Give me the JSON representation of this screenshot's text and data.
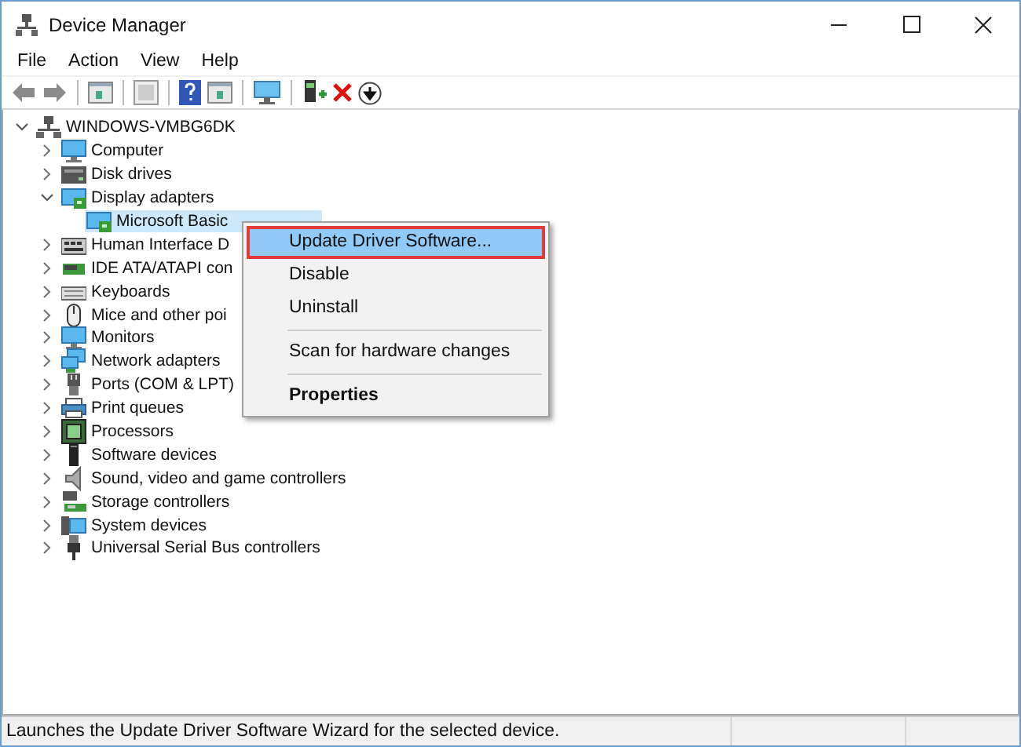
{
  "window": {
    "title": "Device Manager"
  },
  "menu_bar": [
    "File",
    "Action",
    "View",
    "Help"
  ],
  "tree": [
    {
      "label": "WINDOWS-VMBG6DK",
      "expanded": true,
      "selected": false,
      "children": [
        {
          "label": "Computer",
          "expanded": false,
          "selected": false
        },
        {
          "label": "Disk drives",
          "expanded": false,
          "selected": false
        },
        {
          "label": "Display adapters",
          "expanded": true,
          "selected": false,
          "children": [
            {
              "label": "Microsoft Basic",
              "selected": true
            }
          ]
        },
        {
          "label": "Human Interface D",
          "expanded": false,
          "selected": false
        },
        {
          "label": "IDE ATA/ATAPI con",
          "expanded": false,
          "selected": false
        },
        {
          "label": "Keyboards",
          "expanded": false,
          "selected": false
        },
        {
          "label": "Mice and other poi",
          "expanded": false,
          "selected": false
        },
        {
          "label": "Monitors",
          "expanded": false,
          "selected": false
        },
        {
          "label": "Network adapters",
          "expanded": false,
          "selected": false
        },
        {
          "label": "Ports (COM & LPT)",
          "expanded": false,
          "selected": false
        },
        {
          "label": "Print queues",
          "expanded": false,
          "selected": false
        },
        {
          "label": "Processors",
          "expanded": false,
          "selected": false
        },
        {
          "label": "Software devices",
          "expanded": false,
          "selected": false
        },
        {
          "label": "Sound, video and game controllers",
          "expanded": false,
          "selected": false
        },
        {
          "label": "Storage controllers",
          "expanded": false,
          "selected": false
        },
        {
          "label": "System devices",
          "expanded": false,
          "selected": false
        },
        {
          "label": "Universal Serial Bus controllers",
          "expanded": false,
          "selected": false
        }
      ]
    }
  ],
  "context_menu": [
    {
      "kind": "item",
      "label": "Update Driver Software...",
      "selected": true,
      "outlined": true,
      "bold": false
    },
    {
      "kind": "item",
      "label": "Disable",
      "selected": false,
      "outlined": false,
      "bold": false
    },
    {
      "kind": "item",
      "label": "Uninstall",
      "selected": false,
      "outlined": false,
      "bold": false
    },
    {
      "kind": "separator"
    },
    {
      "kind": "item",
      "label": "Scan for hardware changes",
      "selected": false,
      "outlined": false,
      "bold": false
    },
    {
      "kind": "separator"
    },
    {
      "kind": "item",
      "label": "Properties",
      "selected": false,
      "outlined": false,
      "bold": true
    }
  ],
  "status_bar": {
    "text": "Launches the Update Driver Software Wizard for the selected device."
  }
}
